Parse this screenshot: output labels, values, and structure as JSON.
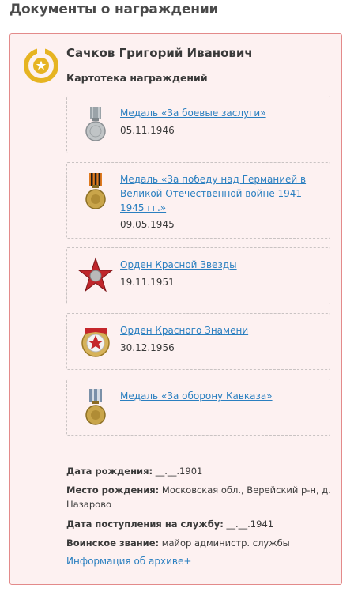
{
  "page": {
    "title": "Документы о награждении"
  },
  "person": {
    "name": "Сачков Григорий Иванович",
    "subtitle": "Картотека награждений"
  },
  "awards": [
    {
      "name": "Медаль «За боевые заслуги»",
      "date": "05.11.1946",
      "icon": "medal-combat-merit-icon"
    },
    {
      "name": "Медаль «За победу над Германией в Великой Отечественной войне 1941–1945 гг.»",
      "date": "09.05.1945",
      "icon": "medal-victory-germany-icon"
    },
    {
      "name": "Орден Красной Звезды",
      "date": "19.11.1951",
      "icon": "order-red-star-icon"
    },
    {
      "name": "Орден Красного Знамени",
      "date": "30.12.1956",
      "icon": "order-red-banner-icon"
    },
    {
      "name": "Медаль «За оборону Кавказа»",
      "date": "",
      "icon": "medal-defense-caucasus-icon"
    }
  ],
  "details": {
    "birth_date_label": "Дата рождения:",
    "birth_date_value": " __.__.1901",
    "birth_place_label": "Место рождения:",
    "birth_place_value": " Московская обл., Верейский р-н, д. Назарово",
    "service_start_label": "Дата поступления на службу:",
    "service_start_value": " __.__.1941",
    "rank_label": "Воинское звание:",
    "rank_value": " майор администр. службы"
  },
  "archive_link": "Информация об архиве+",
  "colors": {
    "card_bg": "#fdf1f1",
    "card_border": "#e38a8a",
    "link": "#2a7fc0",
    "badge_gold": "#e6b422"
  }
}
